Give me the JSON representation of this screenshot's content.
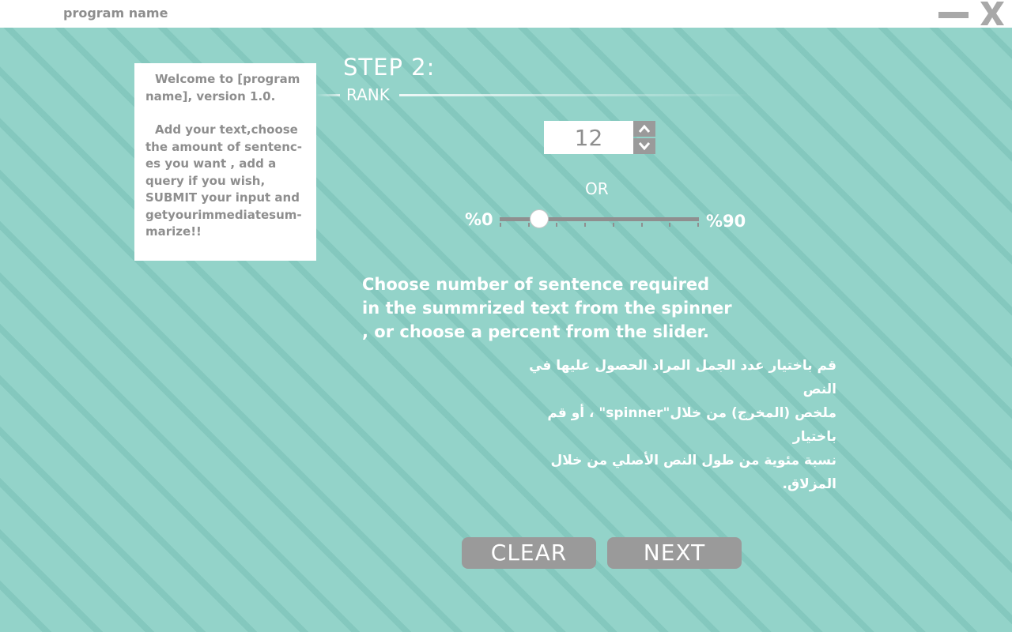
{
  "window": {
    "program_name": "program name",
    "minimize_icon": "minimize-icon",
    "close_icon": "close-icon"
  },
  "welcome": {
    "paragraph1": "Welcome to [program name], version 1.0.",
    "paragraph2": "Add your text,choose the amount of sentenc-es you want , add a query if you wish, SUBMIT your input and getyourimmediatesum-marize!!"
  },
  "step": {
    "title": "STEP 2:",
    "rank_label": "RANK"
  },
  "spinner": {
    "value": "12",
    "up_icon": "chevron-up-icon",
    "down_icon": "chevron-down-icon"
  },
  "or_label": "OR",
  "slider": {
    "min_label": "%0",
    "max_label": "%90",
    "min": 0,
    "max": 90,
    "value": 18,
    "tick_count": 8
  },
  "instructions": {
    "english_lines": [
      "Choose number of sentence required",
      "in the summrized text from the spinner",
      ", or choose a percent from the slider."
    ],
    "arabic_lines": [
      "قم باختيار عدد الجمل المراد الحصول عليها في النص",
      "ملخص (المخرج) من خلال\"spinner\" ، أو قم باختيار",
      "نسبة مئوية من طول النص الأصلي من خلال المزلاق."
    ]
  },
  "buttons": {
    "clear": "CLEAR",
    "next": "NEXT"
  },
  "colors": {
    "background": "#93d3c9",
    "stripe": "#78beb4",
    "button": "#9a9a9a",
    "text_gray": "#8e8e8e",
    "white": "#ffffff"
  }
}
